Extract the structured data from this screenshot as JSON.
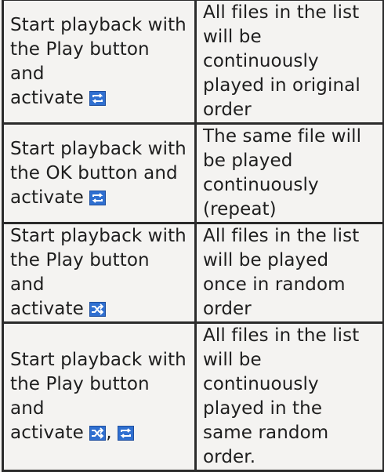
{
  "rows": [
    {
      "mode": {
        "line1": "Start playback with",
        "line2": "the Play button and",
        "line3": "activate",
        "icons": [
          "repeat-icon"
        ]
      },
      "result": "All files in the list will be continuously played in original order"
    },
    {
      "mode": {
        "line1": "Start playback with",
        "line2": "the OK button and",
        "line3": "activate",
        "icons": [
          "repeat-icon"
        ]
      },
      "result": "The same file will be played continuously (repeat)"
    },
    {
      "mode": {
        "line1": "Start playback with",
        "line2": "the Play button and",
        "line3": "activate",
        "icons": [
          "shuffle-icon"
        ]
      },
      "result": "All files in the list will be played once in random order"
    },
    {
      "mode": {
        "line1": "Start playback with",
        "line2": "the Play button and",
        "line3": "activate",
        "icons": [
          "shuffle-icon",
          "repeat-icon"
        ],
        "separator": ","
      },
      "result": "All files in the list will be continuously played in the same random order."
    }
  ],
  "colors": {
    "background": "#f4f3f1",
    "border": "#2b2b2b",
    "text": "#1e1e1e",
    "icon_fill": "#2f6fd0"
  }
}
